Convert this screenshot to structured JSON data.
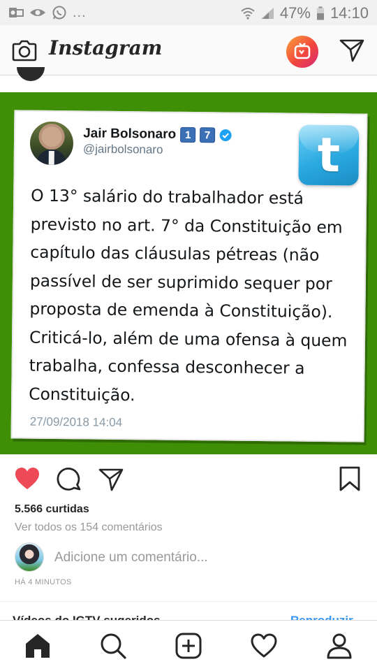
{
  "status_bar": {
    "battery": "47%",
    "time": "14:10",
    "left_icons": [
      "outlook-icon",
      "eye-icon",
      "whatsapp-icon"
    ],
    "more": "..."
  },
  "header": {
    "title": "Instagram",
    "left_icon": "camera-icon",
    "right_icons": [
      "igtv-icon",
      "direct-icon"
    ]
  },
  "post": {
    "background_color": "#3f8f06",
    "tweet": {
      "name": "Jair Bolsonaro",
      "badge_digits": [
        "1",
        "7"
      ],
      "handle": "@jairbolsonaro",
      "text": "O 13° salário do trabalhador está\nprevisto no art. 7° da Constituição em\ncapítulo das cláusulas pétreas (não\npassível de ser suprimido sequer por\nproposta de emenda à Constituição).\nCriticá-lo, além de uma ofensa à quem\ntrabalha, confessa desconhecer a\nConstituição.",
      "date": "27/09/2018 14:04",
      "brand_icon": "twitter-logo",
      "brand_letter": "t"
    }
  },
  "actions": {
    "likes": "5.566 curtidas",
    "view_comments": "Ver todos os 154 comentários",
    "comment_placeholder": "Adicione um comentário...",
    "time_ago": "HÁ 4 MINUTOS",
    "liked_color": "#ed4956"
  },
  "igtv": {
    "suggestions": "Vídeos do IGTV sugeridos",
    "see_all": "Reproduzir"
  },
  "bottom_nav": [
    "home-icon",
    "search-icon",
    "new-post-icon",
    "activity-icon",
    "profile-icon"
  ]
}
